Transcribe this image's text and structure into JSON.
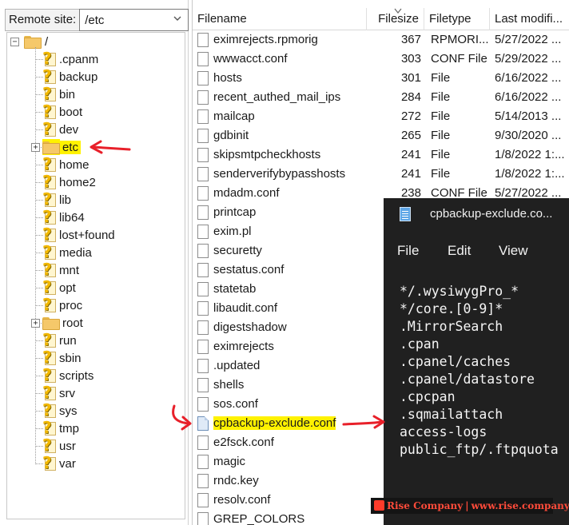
{
  "remote_site": {
    "label": "Remote site:",
    "path": "/etc"
  },
  "tree": {
    "root": "/",
    "items": [
      {
        "name": ".cpanm",
        "icon": "question-folder-icon"
      },
      {
        "name": "backup",
        "icon": "question-folder-icon"
      },
      {
        "name": "bin",
        "icon": "question-folder-icon"
      },
      {
        "name": "boot",
        "icon": "question-folder-icon"
      },
      {
        "name": "dev",
        "icon": "question-folder-icon"
      },
      {
        "name": "etc",
        "icon": "folder-icon",
        "selected": true,
        "expander": "+"
      },
      {
        "name": "home",
        "icon": "question-folder-icon"
      },
      {
        "name": "home2",
        "icon": "question-folder-icon"
      },
      {
        "name": "lib",
        "icon": "question-folder-icon"
      },
      {
        "name": "lib64",
        "icon": "question-folder-icon"
      },
      {
        "name": "lost+found",
        "icon": "question-folder-icon"
      },
      {
        "name": "media",
        "icon": "question-folder-icon"
      },
      {
        "name": "mnt",
        "icon": "question-folder-icon"
      },
      {
        "name": "opt",
        "icon": "question-folder-icon"
      },
      {
        "name": "proc",
        "icon": "question-folder-icon"
      },
      {
        "name": "root",
        "icon": "folder-icon",
        "expander": "+"
      },
      {
        "name": "run",
        "icon": "question-folder-icon"
      },
      {
        "name": "sbin",
        "icon": "question-folder-icon"
      },
      {
        "name": "scripts",
        "icon": "question-folder-icon"
      },
      {
        "name": "srv",
        "icon": "question-folder-icon"
      },
      {
        "name": "sys",
        "icon": "question-folder-icon"
      },
      {
        "name": "tmp",
        "icon": "question-folder-icon"
      },
      {
        "name": "usr",
        "icon": "question-folder-icon"
      },
      {
        "name": "var",
        "icon": "question-folder-icon"
      }
    ]
  },
  "file_list": {
    "columns": [
      "Filename",
      "Filesize",
      "Filetype",
      "Last modifi..."
    ],
    "rows": [
      {
        "name": "eximrejects.rpmorig",
        "size": "367",
        "type": "RPMORI...",
        "modified": "5/27/2022 ..."
      },
      {
        "name": "wwwacct.conf",
        "size": "303",
        "type": "CONF File",
        "modified": "5/29/2022 ..."
      },
      {
        "name": "hosts",
        "size": "301",
        "type": "File",
        "modified": "6/16/2022 ..."
      },
      {
        "name": "recent_authed_mail_ips",
        "size": "284",
        "type": "File",
        "modified": "6/16/2022 ..."
      },
      {
        "name": "mailcap",
        "size": "272",
        "type": "File",
        "modified": "5/14/2013 ..."
      },
      {
        "name": "gdbinit",
        "size": "265",
        "type": "File",
        "modified": "9/30/2020 ..."
      },
      {
        "name": "skipsmtpcheckhosts",
        "size": "241",
        "type": "File",
        "modified": "1/8/2022 1:..."
      },
      {
        "name": "senderverifybypasshosts",
        "size": "241",
        "type": "File",
        "modified": "1/8/2022 1:..."
      },
      {
        "name": "mdadm.conf",
        "size": "238",
        "type": "CONF File",
        "modified": "5/27/2022 ..."
      },
      {
        "name": "printcap",
        "size": "",
        "type": "",
        "modified": ""
      },
      {
        "name": "exim.pl",
        "size": "",
        "type": "",
        "modified": ""
      },
      {
        "name": "securetty",
        "size": "",
        "type": "",
        "modified": ""
      },
      {
        "name": "sestatus.conf",
        "size": "",
        "type": "",
        "modified": ""
      },
      {
        "name": "statetab",
        "size": "",
        "type": "",
        "modified": ""
      },
      {
        "name": "libaudit.conf",
        "size": "",
        "type": "",
        "modified": ""
      },
      {
        "name": "digestshadow",
        "size": "",
        "type": "",
        "modified": ""
      },
      {
        "name": "eximrejects",
        "size": "",
        "type": "",
        "modified": ""
      },
      {
        "name": ".updated",
        "size": "",
        "type": "",
        "modified": ""
      },
      {
        "name": "shells",
        "size": "",
        "type": "",
        "modified": ""
      },
      {
        "name": "sos.conf",
        "size": "",
        "type": "",
        "modified": ""
      },
      {
        "name": "cpbackup-exclude.conf",
        "size": "",
        "type": "",
        "modified": "",
        "highlight": true,
        "special_icon": true
      },
      {
        "name": "e2fsck.conf",
        "size": "",
        "type": "",
        "modified": ""
      },
      {
        "name": "magic",
        "size": "",
        "type": "",
        "modified": ""
      },
      {
        "name": "rndc.key",
        "size": "",
        "type": "",
        "modified": ""
      },
      {
        "name": "resolv.conf",
        "size": "",
        "type": "",
        "modified": ""
      },
      {
        "name": "GREP_COLORS",
        "size": "",
        "type": "",
        "modified": ""
      }
    ]
  },
  "notepad": {
    "title": "cpbackup-exclude.co...",
    "menu": [
      "File",
      "Edit",
      "View"
    ],
    "lines": [
      "*/.wysiwygPro_*",
      "*/core.[0-9]*",
      ".MirrorSearch",
      ".cpan",
      ".cpanel/caches",
      ".cpanel/datastore",
      ".cpcpan",
      ".sqmailattach",
      "access-logs",
      "public_ftp/.ftpquota"
    ]
  },
  "watermark": {
    "brand": "Rise Company",
    "separator": "|",
    "url": "www.rise.company"
  },
  "colors": {
    "highlight": "#fff200",
    "annotation_arrow": "#e8202a",
    "notepad_bg": "#202020"
  }
}
